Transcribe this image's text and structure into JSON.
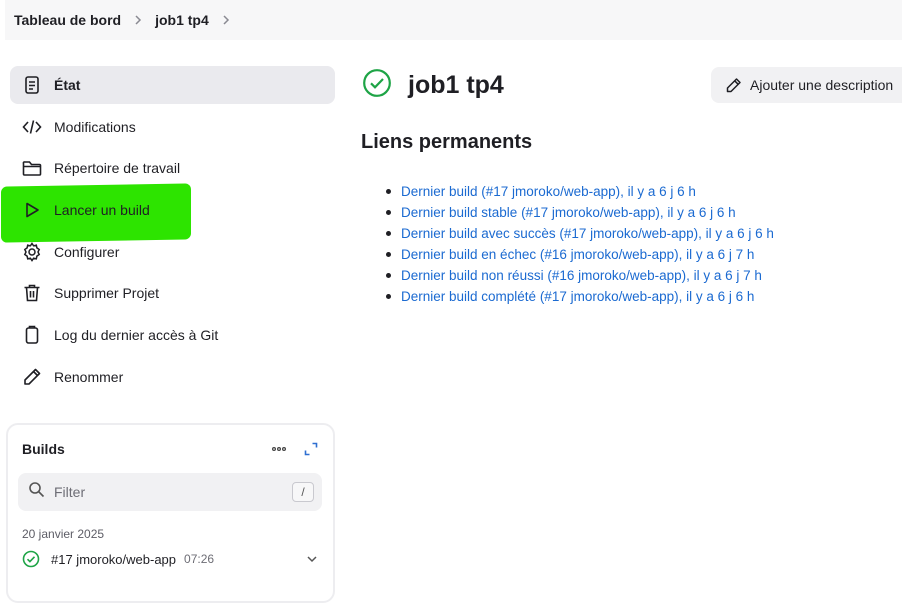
{
  "breadcrumb": {
    "items": [
      "Tableau de bord",
      "job1 tp4"
    ]
  },
  "sidebar": {
    "items": [
      {
        "label": "État",
        "icon": "document-icon"
      },
      {
        "label": "Modifications",
        "icon": "code-icon"
      },
      {
        "label": "Répertoire de travail",
        "icon": "folder-icon"
      },
      {
        "label": "Lancer un build",
        "icon": "play-icon"
      },
      {
        "label": "Configurer",
        "icon": "gear-icon"
      },
      {
        "label": "Supprimer Projet",
        "icon": "trash-icon"
      },
      {
        "label": "Log du dernier accès à Git",
        "icon": "git-log-icon"
      },
      {
        "label": "Renommer",
        "icon": "pencil-icon"
      }
    ],
    "highlight_color": "#2de400"
  },
  "builds": {
    "title": "Builds",
    "filter_placeholder": "Filter",
    "filter_shortcut": "/",
    "date": "20 janvier 2025",
    "rows": [
      {
        "label": "#17 jmoroko/web-app",
        "time": "07:26",
        "status": "success"
      }
    ]
  },
  "main": {
    "title": "job1 tp4",
    "status_color": "#1ea446",
    "add_description_label": "Ajouter une description",
    "permalinks_title": "Liens permanents",
    "permalinks": [
      "Dernier build (#17 jmoroko/web-app), il y a 6 j 6 h",
      "Dernier build stable (#17 jmoroko/web-app), il y a 6 j 6 h",
      "Dernier build avec succès (#17 jmoroko/web-app), il y a 6 j 6 h",
      "Dernier build en échec (#16 jmoroko/web-app), il y a 6 j 7 h",
      "Dernier build non réussi (#16 jmoroko/web-app), il y a 6 j 7 h",
      "Dernier build complété (#17 jmoroko/web-app), il y a 6 j 6 h"
    ],
    "link_color": "#1b6ad1"
  }
}
